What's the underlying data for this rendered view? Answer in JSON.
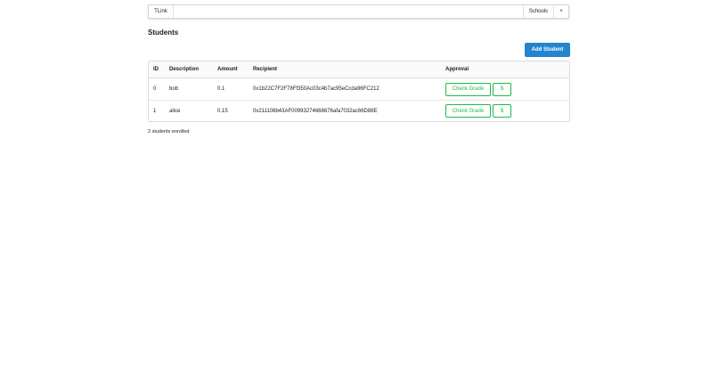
{
  "menu": {
    "brand": "TLink",
    "schools_label": "Schools",
    "plus_label": "+"
  },
  "page": {
    "title": "Students",
    "add_button_label": "Add Student",
    "footer": "2 students enrolled"
  },
  "table": {
    "columns": [
      "ID",
      "Description",
      "Amount",
      "Recipient",
      "Approval"
    ],
    "rows": [
      {
        "id": "0",
        "description": "bob",
        "amount": "0.1",
        "recipient": "0x1b22C7F2F78Ff350Ac03c4b7ac95eCcda96FC212",
        "check_label": "Check Grade",
        "pay_label": "$"
      },
      {
        "id": "1",
        "description": "alice",
        "amount": "0.15",
        "recipient": "0x211108b43AF00993274668676afa7032ac66D88E",
        "check_label": "Check Grade",
        "pay_label": "$"
      }
    ]
  },
  "colors": {
    "primary": "#2185d0",
    "positive": "#21ba45"
  }
}
